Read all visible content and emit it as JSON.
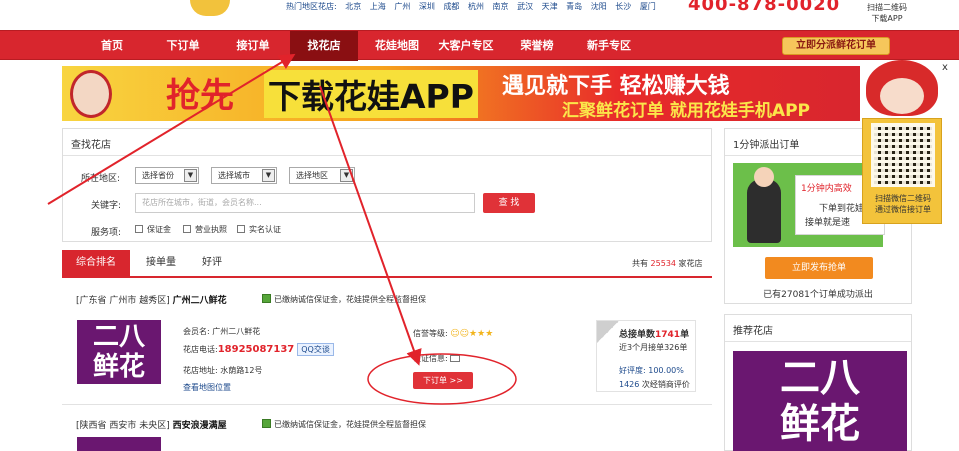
{
  "header": {
    "hot_cities_label": "热门地区花店:",
    "hot_cities": [
      "北京",
      "上海",
      "广州",
      "深圳",
      "成都",
      "杭州",
      "南京",
      "武汉",
      "天津",
      "青岛",
      "沈阳",
      "长沙",
      "厦门"
    ],
    "hotline": "400-878-0020",
    "scan_lines": [
      "扫描二维码",
      "下载APP"
    ]
  },
  "nav": {
    "items": [
      "首页",
      "下订单",
      "接订单",
      "找花店",
      "花娃地图",
      "大客户专区",
      "荣誉榜",
      "新手专区"
    ],
    "active_index": 3,
    "dispatch_button": "立即分派鲜花订单"
  },
  "banner": {
    "rush": "抢先",
    "download": "下载花娃APP",
    "line1": "遇见就下手  轻松赚大钱",
    "line2": "汇聚鲜花订单  就用花娃手机APP"
  },
  "qr_float": {
    "close": "x",
    "text": [
      "扫描微信二维码",
      "通过微信接订单"
    ]
  },
  "search": {
    "title": "查找花店",
    "region_label": "所在地区:",
    "province_placeholder": "选择省份",
    "city_placeholder": "选择城市",
    "district_placeholder": "选择地区",
    "keyword_label": "关键字:",
    "keyword_placeholder": "花店所在城市，街道，会员名称...",
    "search_button": "查 找",
    "service_label": "服务项:",
    "services": [
      "保证金",
      "营业执照",
      "实名认证"
    ]
  },
  "tabs": {
    "items": [
      "综合排名",
      "接单量",
      "好评"
    ],
    "active_index": 0,
    "total_prefix": "共有",
    "total_count": "25534",
    "total_suffix": "家花店"
  },
  "shops": [
    {
      "region": "[广东省 广州市 越秀区]",
      "name": "广州二八鲜花",
      "guarantee": "已缴纳诚信保证金，花娃提供全程监督担保",
      "logo_text": [
        "二八",
        "鲜花"
      ],
      "member_label": "会员名:",
      "member": "广州二八鲜花",
      "phone_label": "花店电话:",
      "phone": "18925087137",
      "qq": "QQ交谈",
      "address_label": "花店地址:",
      "address": "水荫路12号",
      "map_link": "查看地图位置",
      "credit_label": "信誉等级:",
      "verify_label": "认证信息:",
      "order_button": "下订单 >>",
      "total_orders_label": "总接单数",
      "total_orders": "1741",
      "total_orders_unit": "单",
      "recent_orders": "近3个月接单326单",
      "praise_label": "好评度:",
      "praise_rate": "100.00%",
      "reviews_count": "1426",
      "reviews_suffix": "次经销商评价"
    },
    {
      "region": "[陕西省 西安市 未央区]",
      "name": "西安浪漫满屋",
      "guarantee": "已缴纳诚信保证金，花娃提供全程监督担保"
    }
  ],
  "right": {
    "dispatch_title": "1分钟派出订单",
    "illus_red": "1分钟内高效",
    "illus_t1": "下单到花娃",
    "illus_t2": "接单就是速",
    "publish_button": "立即发布抢单",
    "orders_done_prefix": "已有",
    "orders_done_count": "27081",
    "orders_done_suffix": "个订单成功派出",
    "recommend_title": "推荐花店",
    "recommend_logo": [
      "二八",
      "鲜花"
    ]
  },
  "colors": {
    "brand_red": "#d8262e",
    "link_blue": "#1d4a8c",
    "accent_orange": "#f28a1f",
    "logo_purple": "#6a1770"
  }
}
